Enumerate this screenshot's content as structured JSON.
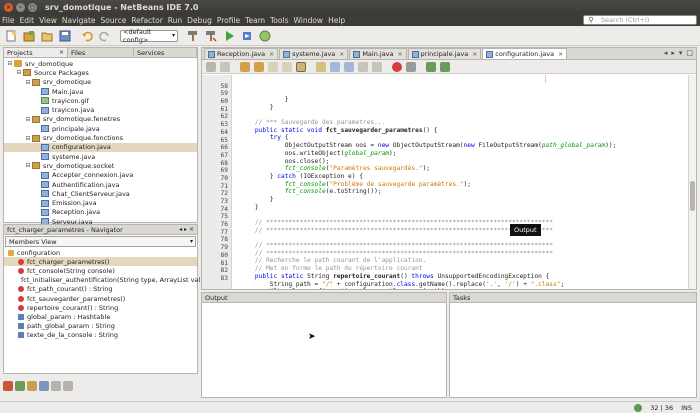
{
  "window": {
    "title": "srv_domotique - NetBeans IDE 7.0",
    "close_glyph": "×",
    "min_glyph": "–",
    "max_glyph": "□"
  },
  "menu": {
    "items": [
      "File",
      "Edit",
      "View",
      "Navigate",
      "Source",
      "Refactor",
      "Run",
      "Debug",
      "Profile",
      "Team",
      "Tools",
      "Window",
      "Help"
    ],
    "search_placeholder": "Search (Ctrl+I)",
    "search_icon": "search-icon"
  },
  "toolbar": {
    "config_value": "<default config>",
    "config_arrow": "▾"
  },
  "left_tabs": {
    "projects": "Projects",
    "files": "Files",
    "services": "Services",
    "close": "×"
  },
  "tree": [
    {
      "label": "srv_domotique",
      "indent": 0,
      "exp": "⊟",
      "icon": "proj"
    },
    {
      "label": "Source Packages",
      "indent": 1,
      "exp": "⊟",
      "icon": "pkg"
    },
    {
      "label": "srv_domotique",
      "indent": 2,
      "exp": "⊟",
      "icon": "pkg"
    },
    {
      "label": "Main.java",
      "indent": 3,
      "exp": "",
      "icon": "java"
    },
    {
      "label": "trayicon.gif",
      "indent": 3,
      "exp": "",
      "icon": "img"
    },
    {
      "label": "trayicon.java",
      "indent": 3,
      "exp": "",
      "icon": "java"
    },
    {
      "label": "srv_domotique.fenetres",
      "indent": 2,
      "exp": "⊟",
      "icon": "pkg"
    },
    {
      "label": "principale.java",
      "indent": 3,
      "exp": "",
      "icon": "java"
    },
    {
      "label": "srv_domotique.fonctions",
      "indent": 2,
      "exp": "⊟",
      "icon": "pkg"
    },
    {
      "label": "configuration.java",
      "indent": 3,
      "exp": "",
      "icon": "java",
      "selected": true
    },
    {
      "label": "systeme.java",
      "indent": 3,
      "exp": "",
      "icon": "java"
    },
    {
      "label": "srv_domotique.socket",
      "indent": 2,
      "exp": "⊟",
      "icon": "pkg"
    },
    {
      "label": "Accepter_connexion.java",
      "indent": 3,
      "exp": "",
      "icon": "java"
    },
    {
      "label": "Authentification.java",
      "indent": 3,
      "exp": "",
      "icon": "java"
    },
    {
      "label": "Chat_ClientServeur.java",
      "indent": 3,
      "exp": "",
      "icon": "java"
    },
    {
      "label": "Emission.java",
      "indent": 3,
      "exp": "",
      "icon": "java"
    },
    {
      "label": "Reception.java",
      "indent": 3,
      "exp": "",
      "icon": "java"
    },
    {
      "label": "Serveur.java",
      "indent": 3,
      "exp": "",
      "icon": "java"
    }
  ],
  "navigator": {
    "title": "fct_charger_parametres - Navigator",
    "ctl1": "◂",
    "ctl2": "▸",
    "close": "×",
    "members_view": "Members View",
    "arrow": "▾",
    "items": [
      {
        "label": "configuration",
        "kind": "cls",
        "indent": 0
      },
      {
        "label": "fct_charger_parametres()",
        "kind": "method",
        "indent": 1,
        "selected": true
      },
      {
        "label": "fct_console(String console)",
        "kind": "method",
        "indent": 1
      },
      {
        "label": "fct_initialiser_authentification(String type, ArrayList val",
        "kind": "method",
        "indent": 1
      },
      {
        "label": "fct_path_courant() : String",
        "kind": "method",
        "indent": 1
      },
      {
        "label": "fct_sauvegarder_parametres()",
        "kind": "method",
        "indent": 1
      },
      {
        "label": "repertoire_courant() : String",
        "kind": "method",
        "indent": 1
      },
      {
        "label": "global_param : Hashtable",
        "kind": "field",
        "indent": 1
      },
      {
        "label": "path_global_param : String",
        "kind": "field",
        "indent": 1
      },
      {
        "label": "texte_de_la_console : String",
        "kind": "field",
        "indent": 1
      }
    ]
  },
  "editor": {
    "tabs": [
      {
        "label": "Reception.java",
        "active": false
      },
      {
        "label": "systeme.java",
        "active": false
      },
      {
        "label": "Main.java",
        "active": false
      },
      {
        "label": "principale.java",
        "active": false
      },
      {
        "label": "configuration.java",
        "active": true
      }
    ],
    "tab_close": "×",
    "tab_controls": [
      "◂",
      "▸",
      "▾",
      "□"
    ],
    "tooltip": "Output",
    "lines": [
      {
        "n": "",
        "html": "            }"
      },
      {
        "n": "58",
        "html": "        }"
      },
      {
        "n": "59",
        "html": ""
      },
      {
        "n": "60",
        "html": "    <span class=\"cm\">// *** Sauvegarde des parametres...</span>"
      },
      {
        "n": "61",
        "html": "    <span class=\"kw\">public static void</span> <span class=\"fn\">fct_sauvegarder_parametres</span>() {"
      },
      {
        "n": "62",
        "html": "        <span class=\"kw\">try</span> {"
      },
      {
        "n": "63",
        "html": "            ObjectOutputStream oos = <span class=\"kw\">new</span> ObjectOutputStream(<span class=\"kw\">new</span> FileOutputStream(<span class=\"it\">path_global_param</span>));"
      },
      {
        "n": "64",
        "html": "            oos.writeObject(<span class=\"it\">global_param</span>);"
      },
      {
        "n": "65",
        "html": "            oos.close();"
      },
      {
        "n": "66",
        "html": "            <span class=\"it\">fct_console</span>(<span class=\"st\">\"Paramètres sauvegardés.\"</span>);"
      },
      {
        "n": "67",
        "html": "        } <span class=\"kw\">catch</span> (IOException e) {"
      },
      {
        "n": "68",
        "html": "            <span class=\"it\">fct_console</span>(<span class=\"st\">\"Problème de sauvegarde paramètres.\"</span>);"
      },
      {
        "n": "69",
        "html": "            <span class=\"it\">fct_console</span>(e.toString());"
      },
      {
        "n": "70",
        "html": "        }"
      },
      {
        "n": "71",
        "html": "    }"
      },
      {
        "n": "72",
        "html": ""
      },
      {
        "n": "73",
        "html": "    <span class=\"cm\">// *****************************************************************************</span>"
      },
      {
        "n": "74",
        "html": "    <span class=\"cm\">// *****************************************************************************</span>"
      },
      {
        "n": "75",
        "html": ""
      },
      {
        "n": "76",
        "html": "    <span class=\"cm\">// *****************************************************************************</span>"
      },
      {
        "n": "77",
        "html": "    <span class=\"cm\">// *****************************************************************************</span>"
      },
      {
        "n": "78",
        "html": "    <span class=\"cm\">// Recherche le path courant de l'application.</span>"
      },
      {
        "n": "79",
        "html": "    <span class=\"cm\">// Met en forme le path du répertoire courant</span>"
      },
      {
        "n": "80",
        "html": "    <span class=\"kw\">public static</span> String <span class=\"fn\">repertoire_courant</span>() <span class=\"kw\">throws</span> UnsupportedEncodingException {"
      },
      {
        "n": "81",
        "html": "        String path = <span class=\"st\">\"/\"</span> + configuration.<span class=\"kw\">class</span>.getName().replace(<span class=\"st\">'.'</span>, <span class=\"st\">'/'</span>) + <span class=\"st\">\".class\"</span>;"
      },
      {
        "n": "82",
        "html": "        URL url = configuration.<span class=\"kw\">class</span>.getResource(path);"
      },
      {
        "n": "83",
        "html": "        path = URLDecoder.decode(url.toString(), <span class=\"st\">\"UTF-8\"</span>);"
      }
    ]
  },
  "output": {
    "title": "Output"
  },
  "tasks": {
    "title": "Tasks"
  },
  "status": {
    "position": "32 | 36",
    "mode": "INS"
  }
}
